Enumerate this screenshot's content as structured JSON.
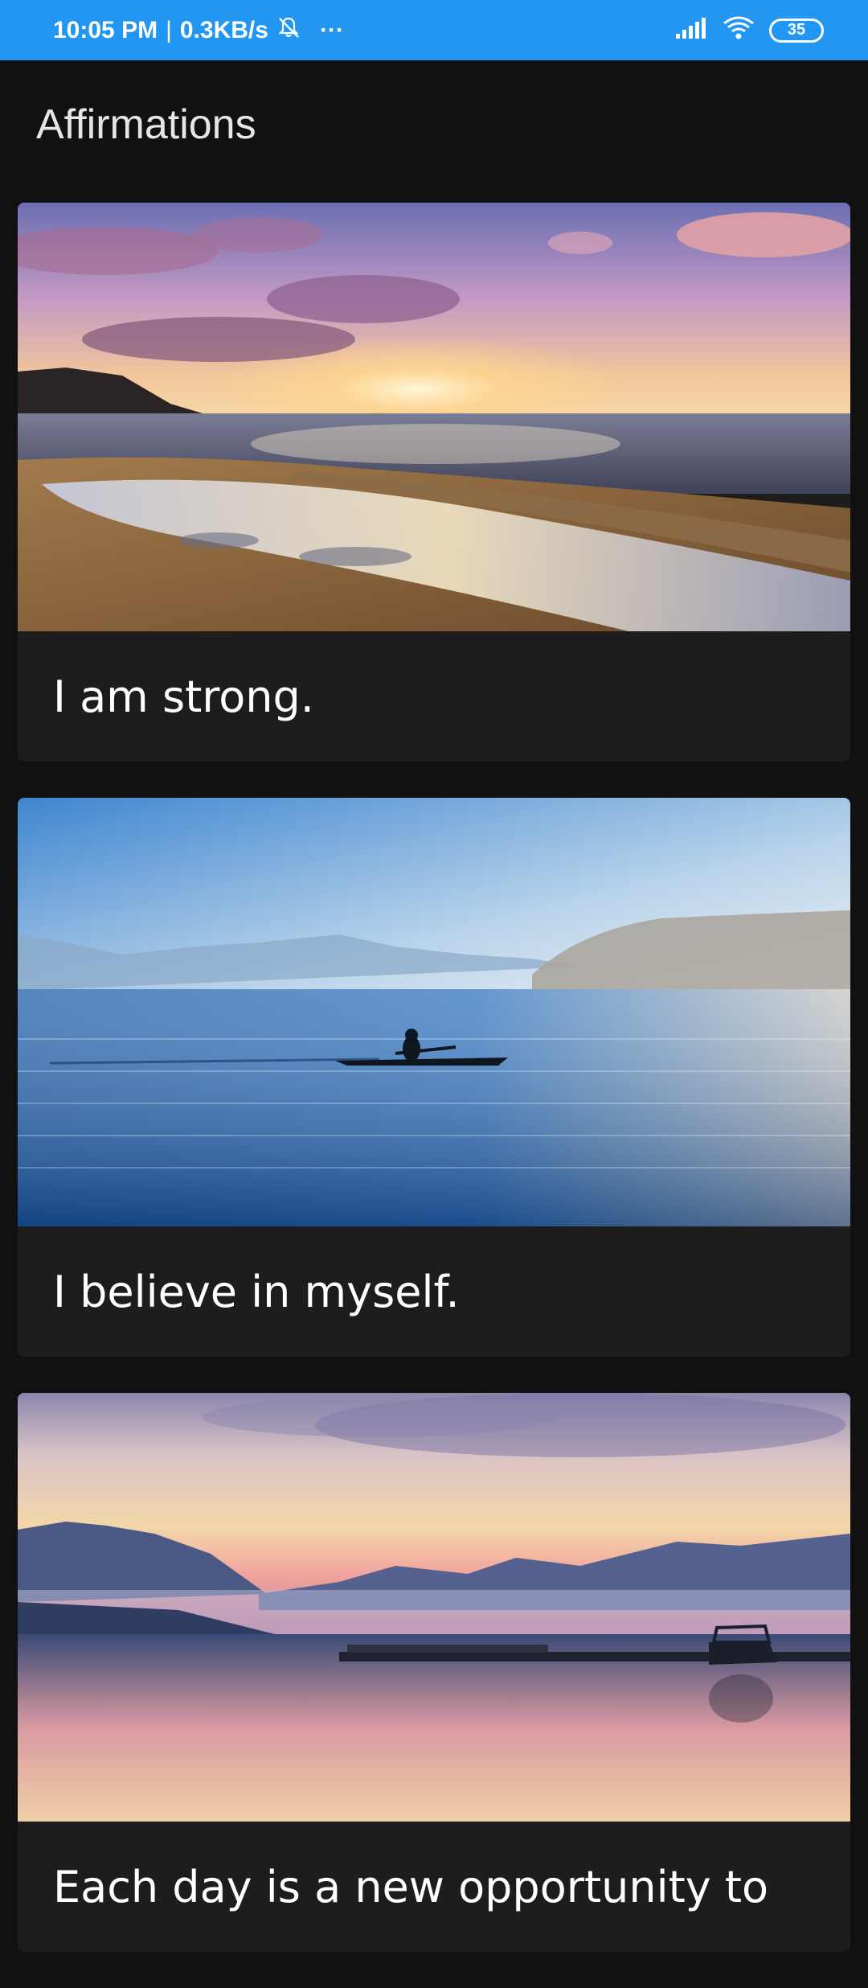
{
  "status_bar": {
    "time": "10:05 PM",
    "separator": "|",
    "net_speed": "0.3KB/s",
    "more": "···",
    "battery": "35"
  },
  "app": {
    "title": "Affirmations"
  },
  "affirmations": [
    {
      "text": "I am strong.",
      "image": "beach-sunset-image"
    },
    {
      "text": "I believe in myself.",
      "image": "lake-kayak-image"
    },
    {
      "text": "Each day is a new opportunity to",
      "image": "mountain-lake-dock-image"
    }
  ],
  "colors": {
    "status_bar": "#2196F3",
    "background": "#111111",
    "card": "#1d1d1d"
  }
}
